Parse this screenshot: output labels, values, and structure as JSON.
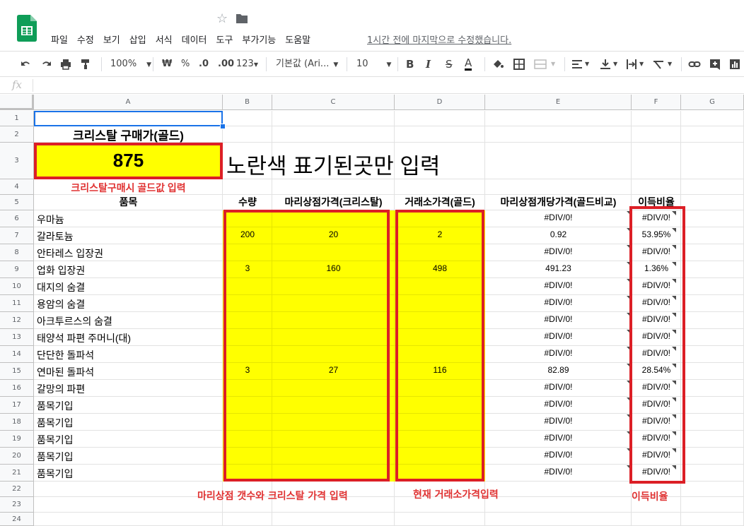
{
  "menu": [
    "파일",
    "수정",
    "보기",
    "삽입",
    "서식",
    "데이터",
    "도구",
    "부가기능",
    "도움말"
  ],
  "last_edit": "1시간 전에 마지막으로 수정했습니다.",
  "toolbar": {
    "zoom": "100%",
    "currency": "₩",
    "percent": "%",
    "dec_less": ".0",
    "dec_more": ".00",
    "more_formats": "123",
    "font": "기본값 (Ari...",
    "font_size": "10",
    "bold": "B",
    "italic": "I",
    "strike": "S",
    "text_color": "A"
  },
  "formula_bar": {
    "fx": "fx"
  },
  "columns": [
    "A",
    "B",
    "C",
    "D",
    "E",
    "F",
    "G"
  ],
  "rows": [
    "1",
    "2",
    "3",
    "4",
    "5",
    "6",
    "7",
    "8",
    "9",
    "10",
    "11",
    "12",
    "13",
    "14",
    "15",
    "16",
    "17",
    "18",
    "19",
    "20",
    "21",
    "22",
    "23",
    "24"
  ],
  "sheet": {
    "title": "크리스탈 구매가(골드)",
    "gold_value": "875",
    "instruction": "노란색 표기된곳만 입력",
    "note_a4": "크리스탈구매시 골드값 입력",
    "headers": [
      "품목",
      "수량",
      "마리상점가격(크리스탈)",
      "거래소가격(골드)",
      "마리상점개당가격(골드비교)",
      "이득비율"
    ],
    "items": [
      {
        "name": "우마늄",
        "qty": "",
        "shop": "",
        "market": "",
        "unit": "#DIV/0!",
        "ratio": "#DIV/0!"
      },
      {
        "name": "갈라토늄",
        "qty": "200",
        "shop": "20",
        "market": "2",
        "unit": "0.92",
        "ratio": "53.95%"
      },
      {
        "name": "안타레스 입장권",
        "qty": "",
        "shop": "",
        "market": "",
        "unit": "#DIV/0!",
        "ratio": "#DIV/0!"
      },
      {
        "name": "업화 입장권",
        "qty": "3",
        "shop": "160",
        "market": "498",
        "unit": "491.23",
        "ratio": "1.36%"
      },
      {
        "name": "대지의 숨결",
        "qty": "",
        "shop": "",
        "market": "",
        "unit": "#DIV/0!",
        "ratio": "#DIV/0!"
      },
      {
        "name": "용암의 숨결",
        "qty": "",
        "shop": "",
        "market": "",
        "unit": "#DIV/0!",
        "ratio": "#DIV/0!"
      },
      {
        "name": "아크투르스의 숨결",
        "qty": "",
        "shop": "",
        "market": "",
        "unit": "#DIV/0!",
        "ratio": "#DIV/0!"
      },
      {
        "name": "태양석 파편 주머니(대)",
        "qty": "",
        "shop": "",
        "market": "",
        "unit": "#DIV/0!",
        "ratio": "#DIV/0!"
      },
      {
        "name": "단단한 돌파석",
        "qty": "",
        "shop": "",
        "market": "",
        "unit": "#DIV/0!",
        "ratio": "#DIV/0!"
      },
      {
        "name": "연마된 돌파석",
        "qty": "3",
        "shop": "27",
        "market": "116",
        "unit": "82.89",
        "ratio": "28.54%"
      },
      {
        "name": "갈망의 파편",
        "qty": "",
        "shop": "",
        "market": "",
        "unit": "#DIV/0!",
        "ratio": "#DIV/0!"
      },
      {
        "name": "품목기입",
        "qty": "",
        "shop": "",
        "market": "",
        "unit": "#DIV/0!",
        "ratio": "#DIV/0!"
      },
      {
        "name": "품목기입",
        "qty": "",
        "shop": "",
        "market": "",
        "unit": "#DIV/0!",
        "ratio": "#DIV/0!"
      },
      {
        "name": "품목기입",
        "qty": "",
        "shop": "",
        "market": "",
        "unit": "#DIV/0!",
        "ratio": "#DIV/0!"
      },
      {
        "name": "품목기입",
        "qty": "",
        "shop": "",
        "market": "",
        "unit": "#DIV/0!",
        "ratio": "#DIV/0!"
      },
      {
        "name": "품목기입",
        "qty": "",
        "shop": "",
        "market": "",
        "unit": "#DIV/0!",
        "ratio": "#DIV/0!"
      }
    ],
    "note_bc": "마리상점 갯수와 크리스탈  가격 입력",
    "note_d": "현재 거래소가격입력",
    "note_f": "이득비율"
  },
  "colors": {
    "yellow": "#ffff00",
    "red": "#dc1f26",
    "accent": "#1a73e8",
    "sheets_green": "#0f9d58"
  }
}
